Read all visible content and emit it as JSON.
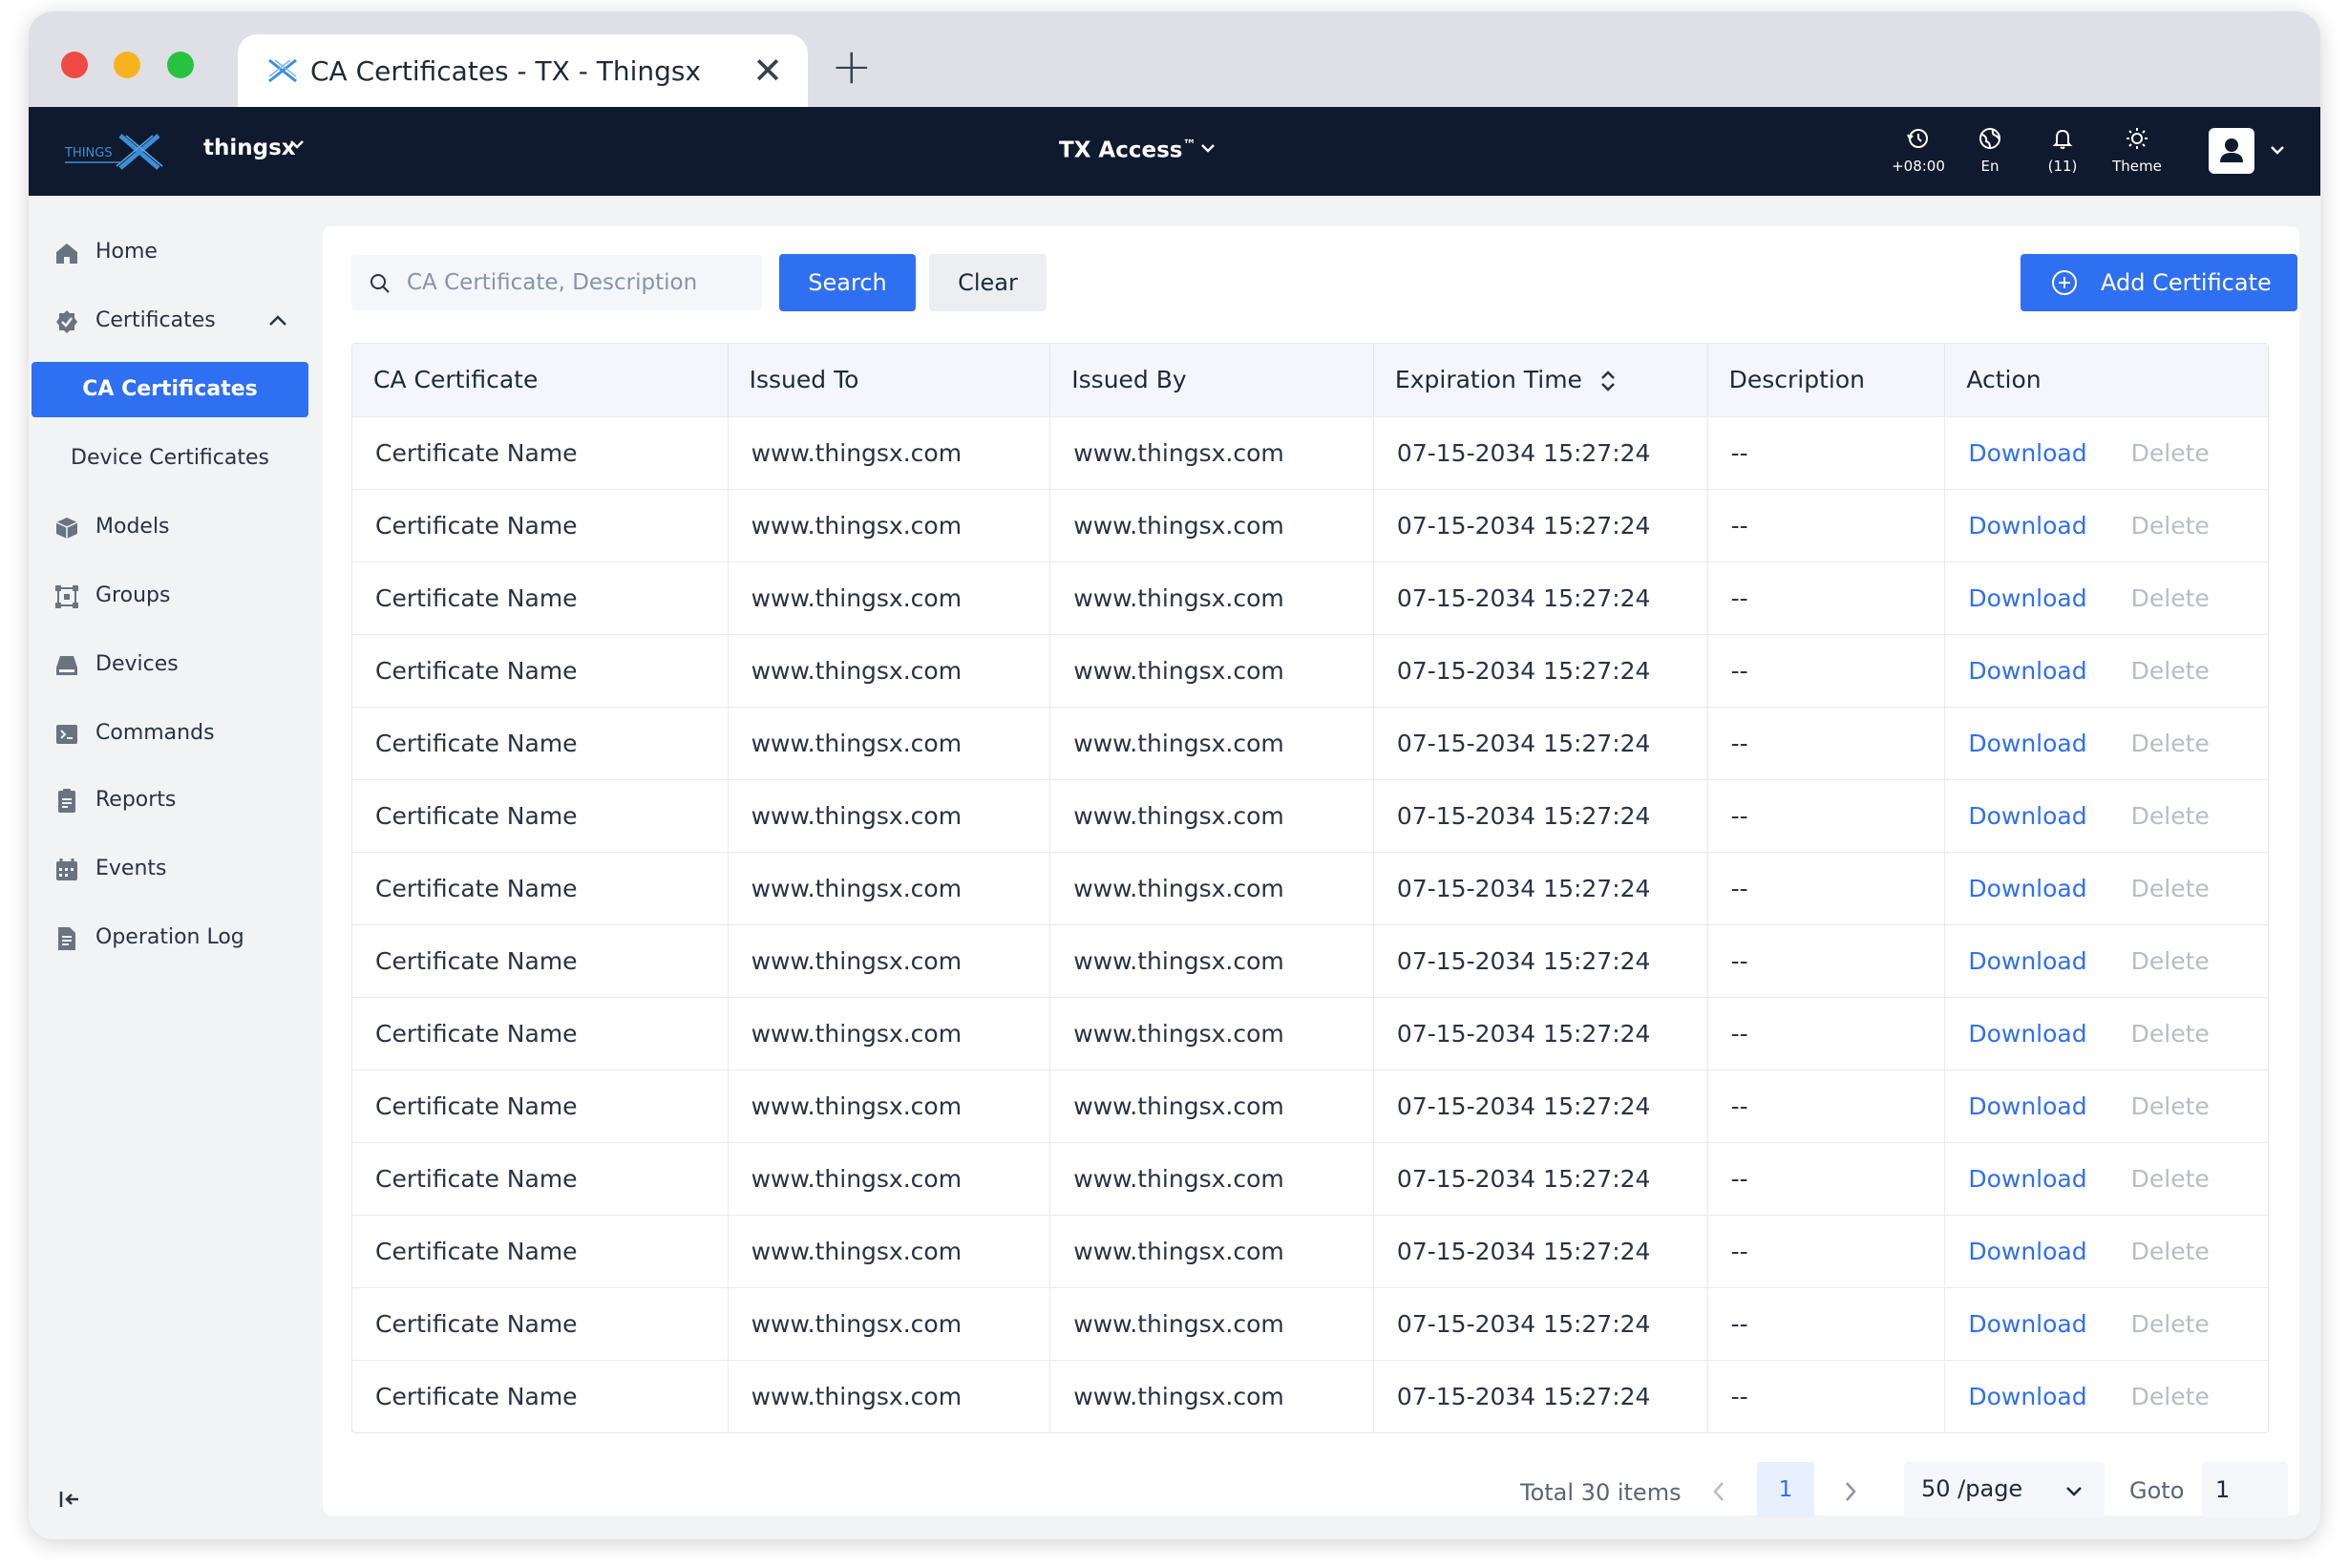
{
  "browser": {
    "tab_title": "CA Certificates - TX - Thingsx",
    "close_symbol": "✕",
    "new_tab_symbol": "+"
  },
  "header": {
    "org_name": "thingsx",
    "product_name": "TX Access",
    "product_mark": "™",
    "timezone": "+08:00",
    "language": "En",
    "notifications": "(11)",
    "theme_label": "Theme"
  },
  "sidebar": {
    "items": [
      {
        "label": "Home",
        "icon": "home-icon"
      },
      {
        "label": "Certificates",
        "icon": "certificate-icon"
      },
      {
        "label": "CA Certificates"
      },
      {
        "label": "Device Certificates"
      },
      {
        "label": "Models",
        "icon": "cube-icon"
      },
      {
        "label": "Groups",
        "icon": "groups-icon"
      },
      {
        "label": "Devices",
        "icon": "device-icon"
      },
      {
        "label": "Commands",
        "icon": "terminal-icon"
      },
      {
        "label": "Reports",
        "icon": "report-icon"
      },
      {
        "label": "Events",
        "icon": "calendar-icon"
      },
      {
        "label": "Operation Log",
        "icon": "log-icon"
      }
    ]
  },
  "toolbar": {
    "search_placeholder": "CA Certificate, Description",
    "search_label": "Search",
    "clear_label": "Clear",
    "add_label": "Add Certificate"
  },
  "table": {
    "columns": [
      "CA Certificate",
      "Issued To",
      "Issued By",
      "Expiration Time",
      "Description",
      "Action"
    ],
    "action_download": "Download",
    "action_delete": "Delete",
    "rows": [
      [
        "Certificate Name",
        "www.thingsx.com",
        "www.thingsx.com",
        "07-15-2034 15:27:24",
        "--"
      ],
      [
        "Certificate Name",
        "www.thingsx.com",
        "www.thingsx.com",
        "07-15-2034 15:27:24",
        "--"
      ],
      [
        "Certificate Name",
        "www.thingsx.com",
        "www.thingsx.com",
        "07-15-2034 15:27:24",
        "--"
      ],
      [
        "Certificate Name",
        "www.thingsx.com",
        "www.thingsx.com",
        "07-15-2034 15:27:24",
        "--"
      ],
      [
        "Certificate Name",
        "www.thingsx.com",
        "www.thingsx.com",
        "07-15-2034 15:27:24",
        "--"
      ],
      [
        "Certificate Name",
        "www.thingsx.com",
        "www.thingsx.com",
        "07-15-2034 15:27:24",
        "--"
      ],
      [
        "Certificate Name",
        "www.thingsx.com",
        "www.thingsx.com",
        "07-15-2034 15:27:24",
        "--"
      ],
      [
        "Certificate Name",
        "www.thingsx.com",
        "www.thingsx.com",
        "07-15-2034 15:27:24",
        "--"
      ],
      [
        "Certificate Name",
        "www.thingsx.com",
        "www.thingsx.com",
        "07-15-2034 15:27:24",
        "--"
      ],
      [
        "Certificate Name",
        "www.thingsx.com",
        "www.thingsx.com",
        "07-15-2034 15:27:24",
        "--"
      ],
      [
        "Certificate Name",
        "www.thingsx.com",
        "www.thingsx.com",
        "07-15-2034 15:27:24",
        "--"
      ],
      [
        "Certificate Name",
        "www.thingsx.com",
        "www.thingsx.com",
        "07-15-2034 15:27:24",
        "--"
      ],
      [
        "Certificate Name",
        "www.thingsx.com",
        "www.thingsx.com",
        "07-15-2034 15:27:24",
        "--"
      ],
      [
        "Certificate Name",
        "www.thingsx.com",
        "www.thingsx.com",
        "07-15-2034 15:27:24",
        "--"
      ]
    ]
  },
  "pagination": {
    "total_text": "Total 30 items",
    "current_page": "1",
    "page_size": "50 /page",
    "goto_label": "Goto",
    "goto_value": "1"
  },
  "colors": {
    "accent": "#2f6ff1",
    "header_bg": "#0f1a2e",
    "delete_disabled": "#b7bcc6"
  }
}
